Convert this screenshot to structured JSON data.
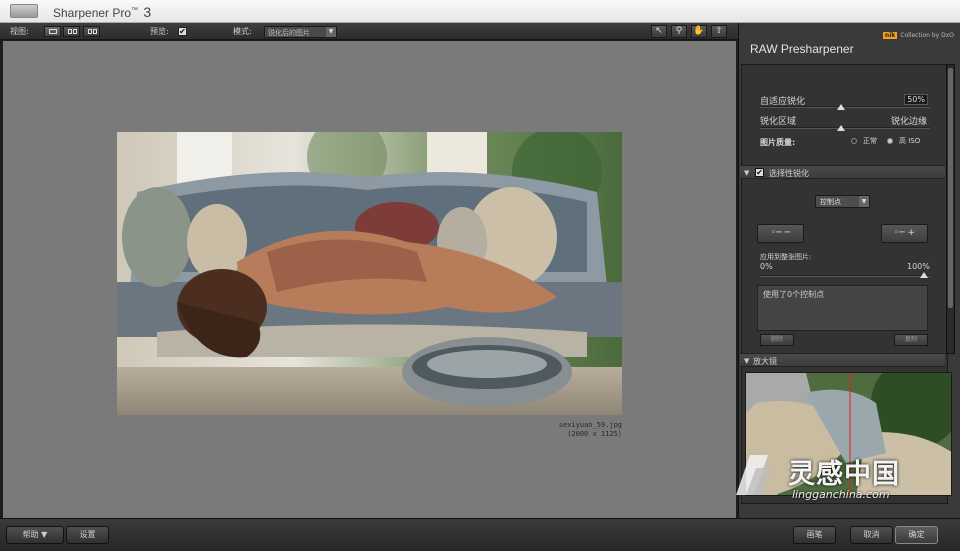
{
  "app": {
    "title": "Sharpener Pro",
    "tm": "™",
    "version": "3"
  },
  "toolbar": {
    "view_label": "视图:",
    "preview_label": "预览:",
    "preview_checked": "✔",
    "mode_label": "模式:",
    "mode_value": "锐化后的图片",
    "tools": [
      "arrow-icon",
      "zoom-icon",
      "hand-icon",
      "upload-icon"
    ]
  },
  "image": {
    "filename": "sexiyuan_59.jpg",
    "dimensions": "(2000 x 1125)"
  },
  "panel": {
    "brand": "Collection by DxO",
    "brand_logo": "nik",
    "title": "RAW Presharpener",
    "adaptive_label": "自适应锐化",
    "adaptive_value": "50%",
    "region_left": "锐化区域",
    "region_right": "锐化边缘",
    "quality_label": "图片质量:",
    "quality_normal": "正常",
    "quality_high": "高 ISO",
    "selective_label": "选择性锐化",
    "control_point_select": "控制点",
    "apply_label": "应用到整张图片:",
    "apply_min": "0%",
    "apply_max": "100%",
    "list_text": "使用了0个控制点",
    "list_btn_left": "删除",
    "list_btn_right": "复制",
    "loupe_label": "放大镜"
  },
  "bottom": {
    "help": "帮助 ▼",
    "settings": "设置",
    "brush": "画笔",
    "cancel": "取消",
    "ok": "确定"
  },
  "watermark": {
    "cn": "灵感中国",
    "url": "lingganchina.com"
  }
}
